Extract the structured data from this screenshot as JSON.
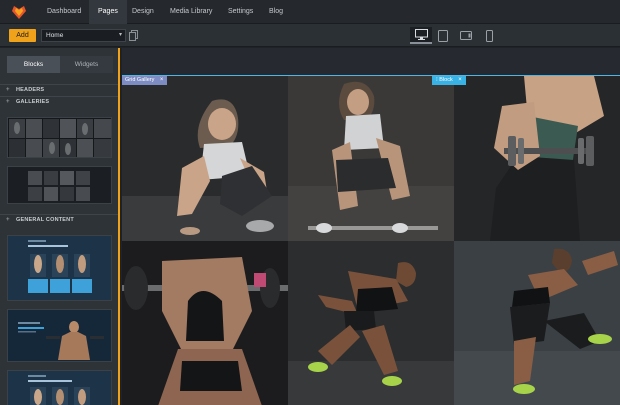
{
  "nav": {
    "items": [
      {
        "label": "Dashboard"
      },
      {
        "label": "Pages"
      },
      {
        "label": "Design"
      },
      {
        "label": "Media Library"
      },
      {
        "label": "Settings"
      },
      {
        "label": "Blog"
      }
    ],
    "active": "Pages"
  },
  "toolbar": {
    "add_label": "Add",
    "page_select_value": "Home",
    "devices": [
      "desktop-icon",
      "tablet-icon",
      "tablet-landscape-icon",
      "phone-icon"
    ],
    "active_device": "desktop"
  },
  "sidebar": {
    "tabs": [
      "Blocks",
      "Widgets"
    ],
    "active_tab": "Blocks",
    "sections": [
      "HEADERS",
      "GALLERIES",
      "GENERAL CONTENT"
    ],
    "accent_color": "#f0a21a"
  },
  "canvas": {
    "gallery_label": "Grid Gallery",
    "block_label": "Block",
    "close_glyph": "×"
  },
  "colors": {
    "topbar": "#25292e",
    "accent": "#f0a21a",
    "selection": "#4fb6e6"
  }
}
